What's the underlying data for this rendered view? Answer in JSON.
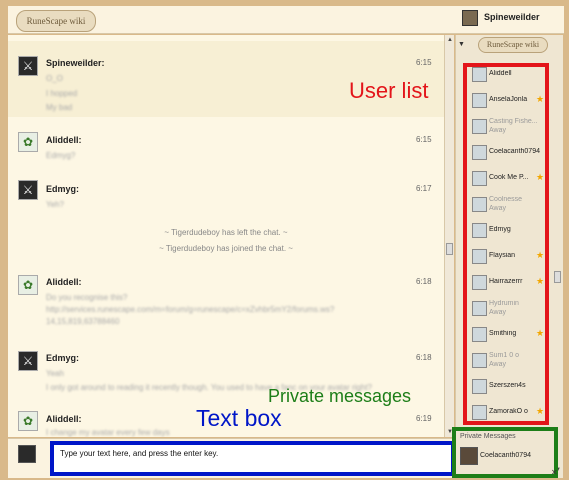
{
  "header": {
    "logo_text": "RuneScape wiki",
    "current_user": "Spineweilder"
  },
  "chat": {
    "messages": [
      {
        "name": "Spineweilder:",
        "time": "6:15",
        "lines": [
          "O_O",
          "I hopped",
          "My bad"
        ],
        "avatar": "dark"
      },
      {
        "name": "Aliddell:",
        "time": "6:15",
        "lines": [
          "Edmyg?"
        ],
        "avatar": "frog"
      },
      {
        "name": "Edmyg:",
        "time": "6:17",
        "lines": [
          "Yeh?"
        ],
        "avatar": "dark"
      },
      {
        "name": "Aliddell:",
        "time": "6:18",
        "lines": [
          "Do you recognise this?",
          "http://services.runescape.com/m=forum/g=runescape/c=xZvhbr5mY2/forums.ws?",
          "14,15,819,63788460"
        ],
        "avatar": "frog"
      },
      {
        "name": "Edmyg:",
        "time": "6:18",
        "lines": [
          "Yeah",
          "I only got around to reading it recently though. You used to have a fanc on your avatar right?"
        ],
        "avatar": "dark"
      },
      {
        "name": "Aliddell:",
        "time": "6:19",
        "lines": [
          "I change my avatar every few days"
        ],
        "avatar": "frog"
      }
    ],
    "inline_events": [
      "~ Tigerdudeboy has left the chat. ~",
      "~ Tigerdudeboy has joined the chat. ~"
    ]
  },
  "input": {
    "text": "Type your text here, and press the enter key."
  },
  "sidebar": {
    "logo_text": "RuneScape wiki",
    "users": [
      {
        "name": "Aliddell",
        "status": "",
        "star": false
      },
      {
        "name": "AnselaJonla",
        "status": "",
        "star": true
      },
      {
        "name": "Casting Fishe...",
        "status": "Away",
        "star": false
      },
      {
        "name": "Coelacanth0794",
        "status": "",
        "star": false
      },
      {
        "name": "Cook Me P...",
        "status": "",
        "star": true
      },
      {
        "name": "Coolnesse",
        "status": "Away",
        "star": false
      },
      {
        "name": "Edmyg",
        "status": "",
        "star": false
      },
      {
        "name": "Flaysian",
        "status": "",
        "star": true
      },
      {
        "name": "Hairrazerrr",
        "status": "",
        "star": true
      },
      {
        "name": "Hydrumin",
        "status": "Away",
        "star": false
      },
      {
        "name": "Smithing",
        "status": "",
        "star": true
      },
      {
        "name": "Sum1 0 o",
        "status": "Away",
        "star": false
      },
      {
        "name": "Szerszen4s",
        "status": "",
        "star": false
      },
      {
        "name": "ZamorakO o",
        "status": "",
        "star": true
      }
    ],
    "private_messages_title": "Private Messages",
    "private_messages_user": "Coelacanth0794"
  },
  "annotations": {
    "user_list": "User list",
    "private_messages": "Private messages",
    "text_box": "Text box"
  },
  "colors": {
    "user_list_box": "#e3151a",
    "private_messages_box": "#1d7e18",
    "text_box": "#0016c8",
    "star": "#f2a600"
  }
}
